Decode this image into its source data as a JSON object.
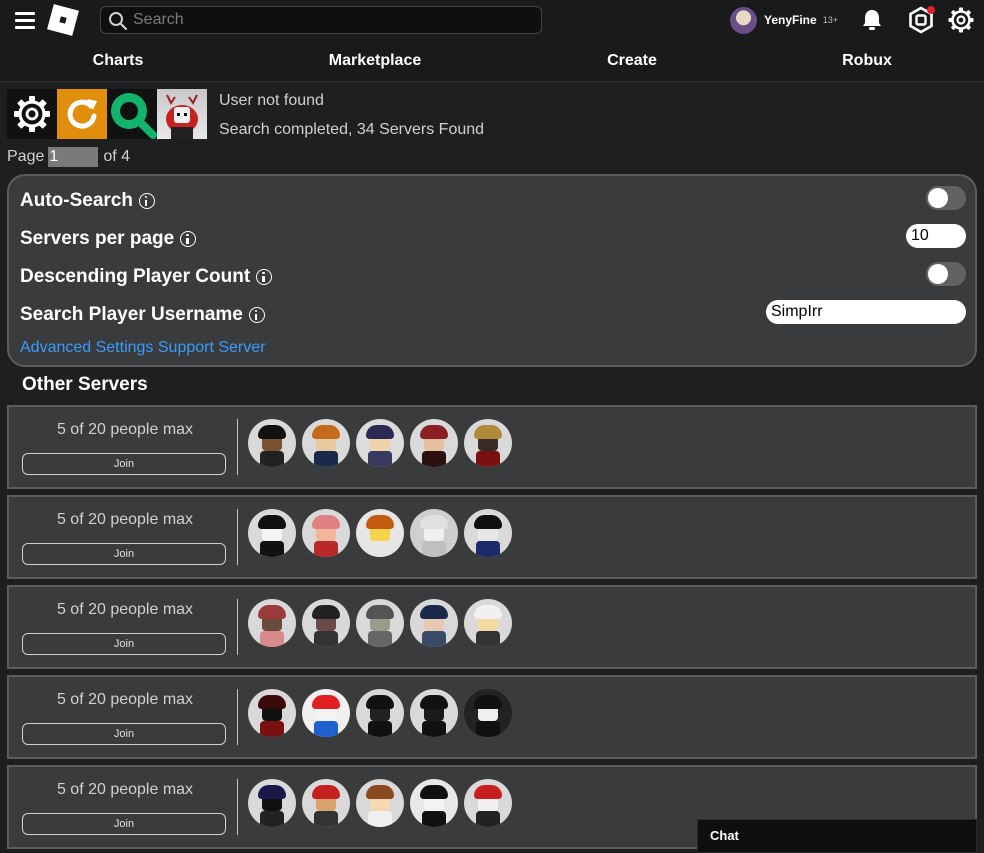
{
  "header": {
    "search_placeholder": "Search",
    "username": "YenyFine",
    "age_badge": "13+",
    "nav": [
      "Charts",
      "Marketplace",
      "Create",
      "Robux"
    ]
  },
  "status": {
    "line1": "User not found",
    "line2": "Search completed, 34 Servers Found"
  },
  "pager": {
    "prefix": "Page",
    "current": "1",
    "suffix": "of 4"
  },
  "settings": {
    "auto_search": {
      "label": "Auto-Search",
      "enabled": false
    },
    "servers_per_page": {
      "label": "Servers per page",
      "value": "10"
    },
    "descending": {
      "label": "Descending Player Count",
      "enabled": false
    },
    "username_search": {
      "label": "Search Player Username",
      "value": "SimpIrr"
    },
    "link_advanced": "Advanced Settings",
    "link_support": "Support Server"
  },
  "other_servers": {
    "title": "Other Servers",
    "join_label": "Join",
    "servers": [
      {
        "count": "5 of 20 people max",
        "players": [
          {
            "bg": "#d9d9d9",
            "hair": "#111",
            "head": "#7a5230",
            "body": "#222"
          },
          {
            "bg": "#d9d9d9",
            "hair": "#c46a1a",
            "head": "#e8c9a0",
            "body": "#1a2a4a"
          },
          {
            "bg": "#dcdcdc",
            "hair": "#2a2a55",
            "head": "#f0d2a8",
            "body": "#3a3a60"
          },
          {
            "bg": "#d9d9d9",
            "hair": "#8a1f24",
            "head": "#e6c0a0",
            "body": "#2b1010"
          },
          {
            "bg": "#d9d9d9",
            "hair": "#b08a3a",
            "head": "#3a2a2a",
            "body": "#7a1010"
          }
        ]
      },
      {
        "count": "5 of 20 people max",
        "players": [
          {
            "bg": "#d9d9d9",
            "hair": "#111",
            "head": "#f4f4f4",
            "body": "#111"
          },
          {
            "bg": "#d9d9d9",
            "hair": "#e08080",
            "head": "#f2b59a",
            "body": "#b82a2a"
          },
          {
            "bg": "#e6e6e6",
            "hair": "#c45a10",
            "head": "#f5d34a",
            "body": "#e6e6e6"
          },
          {
            "bg": "#cfcfcf",
            "hair": "#e0e0e0",
            "head": "#f0f0f0",
            "body": "#bfbfbf"
          },
          {
            "bg": "#d9d9d9",
            "hair": "#111",
            "head": "#e8e8e8",
            "body": "#1a2a6a"
          }
        ]
      },
      {
        "count": "5 of 20 people max",
        "players": [
          {
            "bg": "#d9d9d9",
            "hair": "#9a3a3a",
            "head": "#6a4a3a",
            "body": "#d98a8a"
          },
          {
            "bg": "#d9d9d9",
            "hair": "#222",
            "head": "#6a4a4a",
            "body": "#333"
          },
          {
            "bg": "#d9d9d9",
            "hair": "#555",
            "head": "#9a9a8a",
            "body": "#666"
          },
          {
            "bg": "#d9d9d9",
            "hair": "#1a2a4a",
            "head": "#e8c8b0",
            "body": "#3a4a6a"
          },
          {
            "bg": "#d9d9d9",
            "hair": "#f0f0f0",
            "head": "#f5d9a0",
            "body": "#333"
          }
        ]
      },
      {
        "count": "5 of 20 people max",
        "players": [
          {
            "bg": "#d9d9d9",
            "hair": "#3a0a0a",
            "head": "#111",
            "body": "#7a1010"
          },
          {
            "bg": "#f0f0f0",
            "hair": "#e02020",
            "head": "#f4f4f4",
            "body": "#2060d0"
          },
          {
            "bg": "#d9d9d9",
            "hair": "#111",
            "head": "#222",
            "body": "#111"
          },
          {
            "bg": "#d9d9d9",
            "hair": "#111",
            "head": "#1a1a1a",
            "body": "#111"
          },
          {
            "bg": "#222",
            "hair": "#111",
            "head": "#f0f0f0",
            "body": "#111"
          }
        ]
      },
      {
        "count": "5 of 20 people max",
        "players": [
          {
            "bg": "#d9d9d9",
            "hair": "#1a1a4a",
            "head": "#111",
            "body": "#222"
          },
          {
            "bg": "#d9d9d9",
            "hair": "#c42020",
            "head": "#d9a070",
            "body": "#333"
          },
          {
            "bg": "#d9d9d9",
            "hair": "#8a4a20",
            "head": "#f4d9b0",
            "body": "#f0f0f0"
          },
          {
            "bg": "#e8e8e8",
            "hair": "#111",
            "head": "#f4f4f4",
            "body": "#111"
          },
          {
            "bg": "#d9d9d9",
            "hair": "#c82020",
            "head": "#f0f0f0",
            "body": "#222"
          }
        ]
      }
    ]
  },
  "chat": {
    "label": "Chat"
  },
  "colors": {
    "link": "#3a9bff",
    "panel": "#393b3d",
    "refresh_tile": "#e08e0b",
    "find_tile": "#12b36b"
  }
}
